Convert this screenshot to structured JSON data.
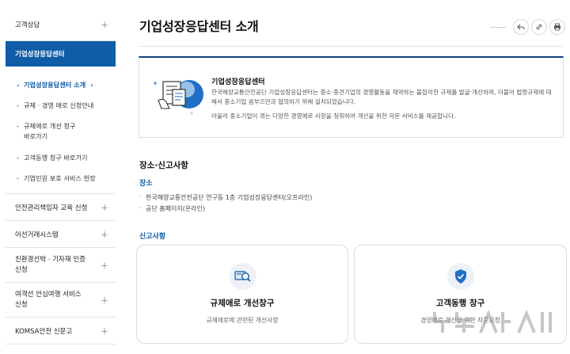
{
  "sidebar": {
    "top_item": "고객상담",
    "active_item": "기업성장응답센터",
    "submenu": [
      {
        "label": "기업성장응답센터 소개",
        "current": true
      },
      {
        "label": "규제 · 경영 애로 신청안내",
        "current": false
      },
      {
        "label": "규제애로 개선 청구\n바로가기",
        "current": false
      },
      {
        "label": "고객동행 청구 바로가기",
        "current": false
      },
      {
        "label": "기업민원 보호 서비스 헌장",
        "current": false
      }
    ],
    "items": [
      {
        "label": "안전관리책임자 교육 신청"
      },
      {
        "label": "어선거래시스템"
      },
      {
        "label": "친환경선박 · 기자재 인증\n신청"
      },
      {
        "label": "여객선 안심여행 서비스\n신청"
      },
      {
        "label": "KOMSA안전 신문고"
      }
    ],
    "plus_symbol": "+",
    "current_marker": "-",
    "chevron": "›"
  },
  "header": {
    "title": "기업성장응답센터 소개"
  },
  "toolbar": {
    "share_icon": "share-icon",
    "link_icon": "link-icon",
    "print_icon": "print-icon"
  },
  "intro": {
    "title": "기업성장응답센터",
    "text": "한국해양교통안전공단 기업성장응답센터는 중소·중견기업의 경영활동을 제약하는 불합리한 규제를 발굴·개선하며, 더불어 법령규제에 대해서 중소기업 옴부즈만과 협의하기 위해 설치되었습니다.",
    "text2": "아울러 중소기업이 겪는 다양한 경영애로 사항을 청취하여 개선을 위한 자문 서비스를 제공합니다."
  },
  "location": {
    "section_title": "장소·신고사항",
    "place_heading": "장소",
    "bullets": [
      "한국해양교통안전공단 연구동 1층 기업성장응답센터(오프라인)",
      "공단 홈페이지(온라인)"
    ],
    "report_heading": "신고사항"
  },
  "cards": [
    {
      "title": "규제애로 개선창구",
      "desc": "규제애로에 관련된 개선사항",
      "icon": "search-document-icon"
    },
    {
      "title": "고객동행 창구",
      "desc": "경영애로 개선을 위한 자문요청",
      "icon": "shield-check-icon"
    }
  ],
  "colors": {
    "accent": "#0f5ca8",
    "intro_border": "#0f3f7a"
  },
  "watermark": "뉴시스"
}
